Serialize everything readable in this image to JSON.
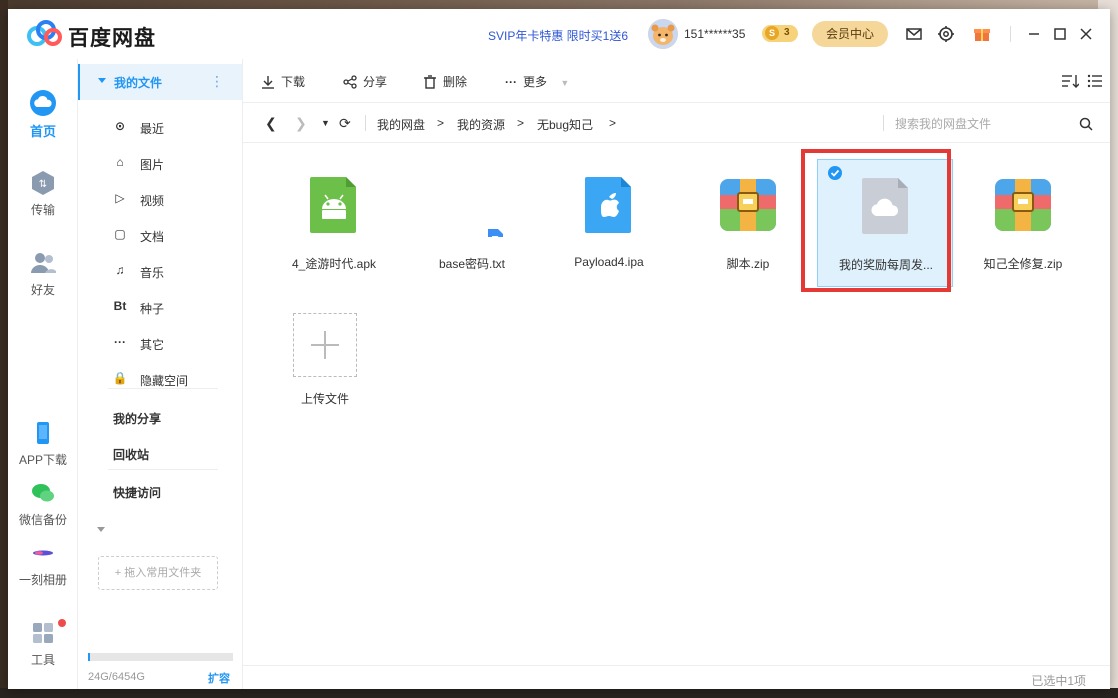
{
  "app": {
    "brand": "百度网盘",
    "promo": "SVIP年卡特惠 限时买1送6",
    "username": "151******35",
    "coin_letter": "S",
    "coin_count": "3",
    "vip_button": "会员中心"
  },
  "rail": {
    "home": "首页",
    "transfer": "传输",
    "friends": "好友",
    "app_download": "APP下载",
    "wechat_backup": "微信备份",
    "album": "一刻相册",
    "tools": "工具"
  },
  "sidebar": {
    "my_files": "我的文件",
    "items": [
      {
        "icon": "⊙",
        "label": "最近"
      },
      {
        "icon": "⌂",
        "label": "图片"
      },
      {
        "icon": "▷",
        "label": "视频"
      },
      {
        "icon": "▢",
        "label": "文档"
      },
      {
        "icon": "♫",
        "label": "音乐"
      },
      {
        "icon": "Bt",
        "label": "种子"
      },
      {
        "icon": "···",
        "label": "其它"
      },
      {
        "icon": "🔒",
        "label": "隐藏空间"
      }
    ],
    "my_share": "我的分享",
    "recycle": "回收站",
    "quick_access": "快捷访问",
    "drag_hint": "+ 拖入常用文件夹",
    "storage_used_fraction": 0.004,
    "storage_text": "24G/6454G",
    "expand": "扩容"
  },
  "toolbar": {
    "download": "下载",
    "share": "分享",
    "delete": "删除",
    "more": "更多"
  },
  "breadcrumb": [
    "我的网盘",
    "我的资源",
    "无bug知己"
  ],
  "breadcrumb_sep": ">",
  "search": {
    "placeholder": "搜索我的网盘文件"
  },
  "files": [
    {
      "name": "4_途游时代.apk",
      "type": "apk",
      "selected": false
    },
    {
      "name": "base密码.txt",
      "type": "txt",
      "selected": false
    },
    {
      "name": "Payload4.ipa",
      "type": "ipa",
      "selected": false
    },
    {
      "name": "脚本.zip",
      "type": "zip",
      "selected": false
    },
    {
      "name": "我的奖励每周发...",
      "type": "cloud",
      "selected": true
    },
    {
      "name": "知己全修复.zip",
      "type": "zip",
      "selected": false
    }
  ],
  "upload_label": "上传文件",
  "status": "已选中1项",
  "colors": {
    "accent": "#2196f3",
    "highlight_frame": "#e53935",
    "selected_bg": "#dff1fd",
    "apk_green": "#6cc04a",
    "ipa_blue": "#3aa6f4"
  }
}
